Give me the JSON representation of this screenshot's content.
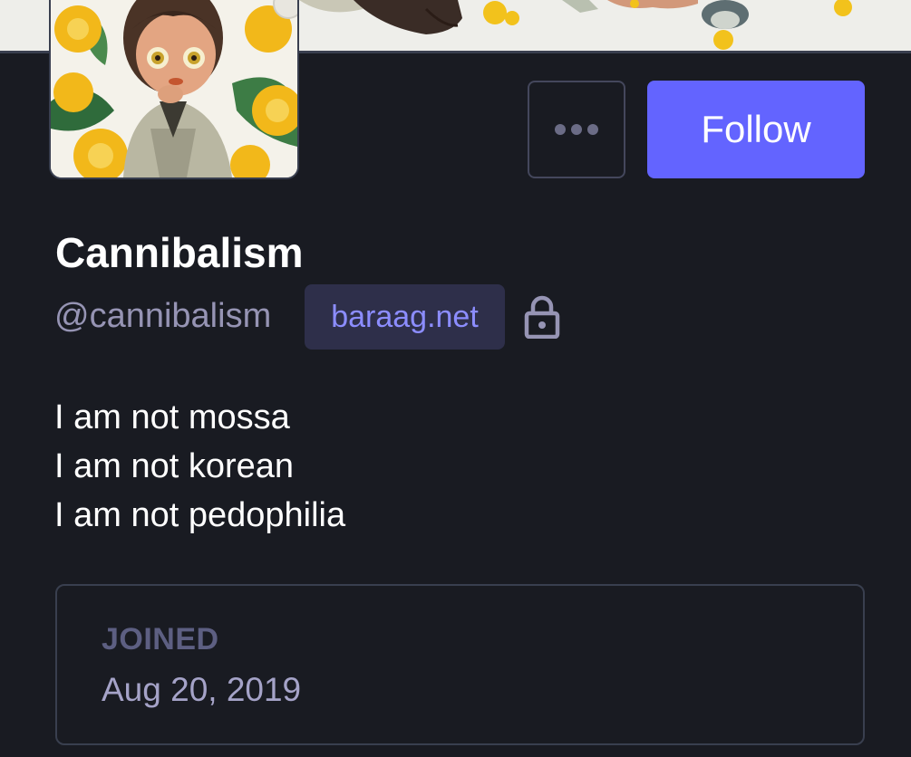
{
  "profile": {
    "display_name": "Cannibalism",
    "username": "@cannibalism",
    "domain": "baraag.net",
    "bio_lines": [
      "I am not mossa",
      "I am not korean",
      "I am not pedophilia"
    ],
    "locked_icon": "lock-icon"
  },
  "actions": {
    "more_icon": "ellipsis-icon",
    "follow_label": "Follow"
  },
  "fields": {
    "joined_label": "JOINED",
    "joined_date": "Aug 20, 2019"
  },
  "colors": {
    "background": "#191b22",
    "accent": "#6364ff",
    "badge_bg": "#2e2f4a",
    "badge_text": "#8c8dff",
    "muted_text": "#9694b4"
  }
}
